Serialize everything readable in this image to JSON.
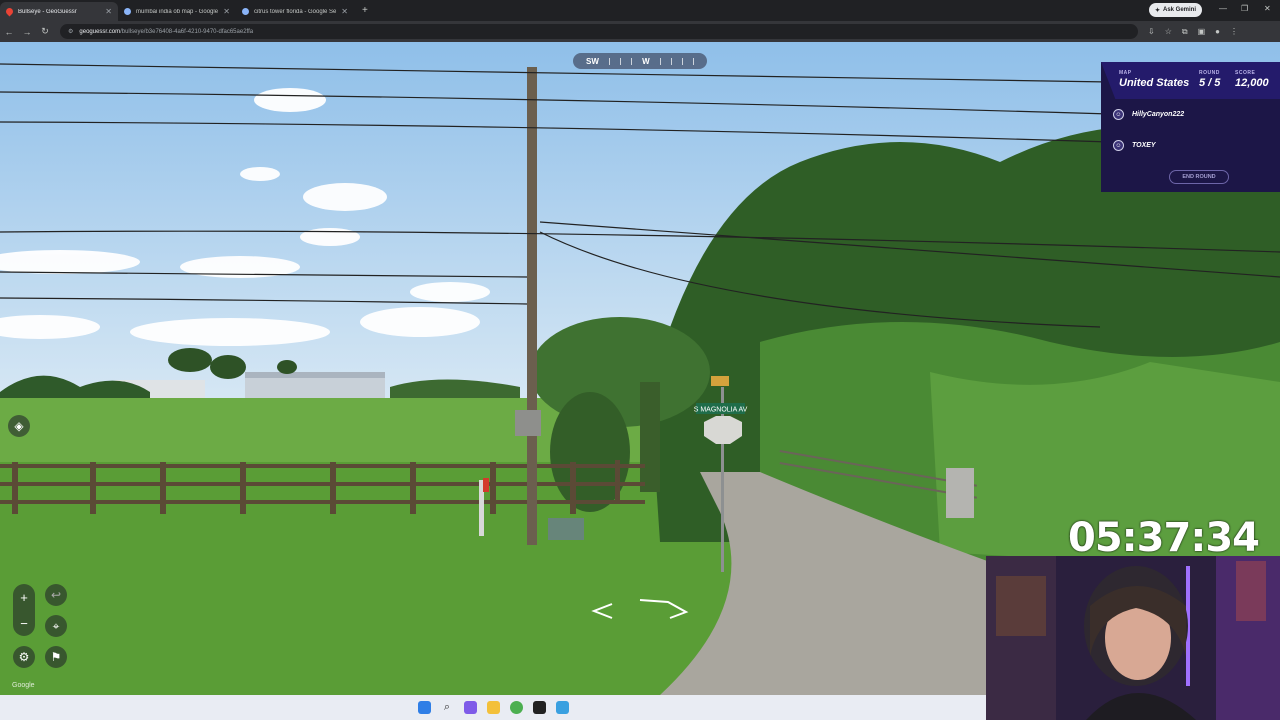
{
  "browser": {
    "tabs": [
      {
        "title": "Bullseye - GeoGuessr",
        "active": true
      },
      {
        "title": "mumbai india ob map - Google",
        "active": false
      },
      {
        "title": "citrus tower florida - Google Se",
        "active": false
      }
    ],
    "ask_gemini": "Ask Gemini",
    "url_host": "geoguessr.com",
    "url_path": "/bullseye/b3e76408-4a6f-4210-9470-dfac65ae2ffa"
  },
  "compass": {
    "labels": [
      "SW",
      "W"
    ]
  },
  "game": {
    "map_label": "MAP",
    "map_value": "United States",
    "round_label": "ROUND",
    "round_value": "5 / 5",
    "score_label": "SCORE",
    "score_value": "12,000",
    "players": [
      "HillyCanyon222",
      "TOXEY"
    ],
    "end_round": "END ROUND"
  },
  "streetview": {
    "street_sign": "S MAGNOLIA AV",
    "google_watermark": "Google"
  },
  "timer": "05:37:34",
  "colors": {
    "panel": "#1c1647",
    "panel_header": "#241b6b",
    "sky": "#9cc8ec",
    "grass": "#5fa33b",
    "road": "#a8a59c"
  }
}
